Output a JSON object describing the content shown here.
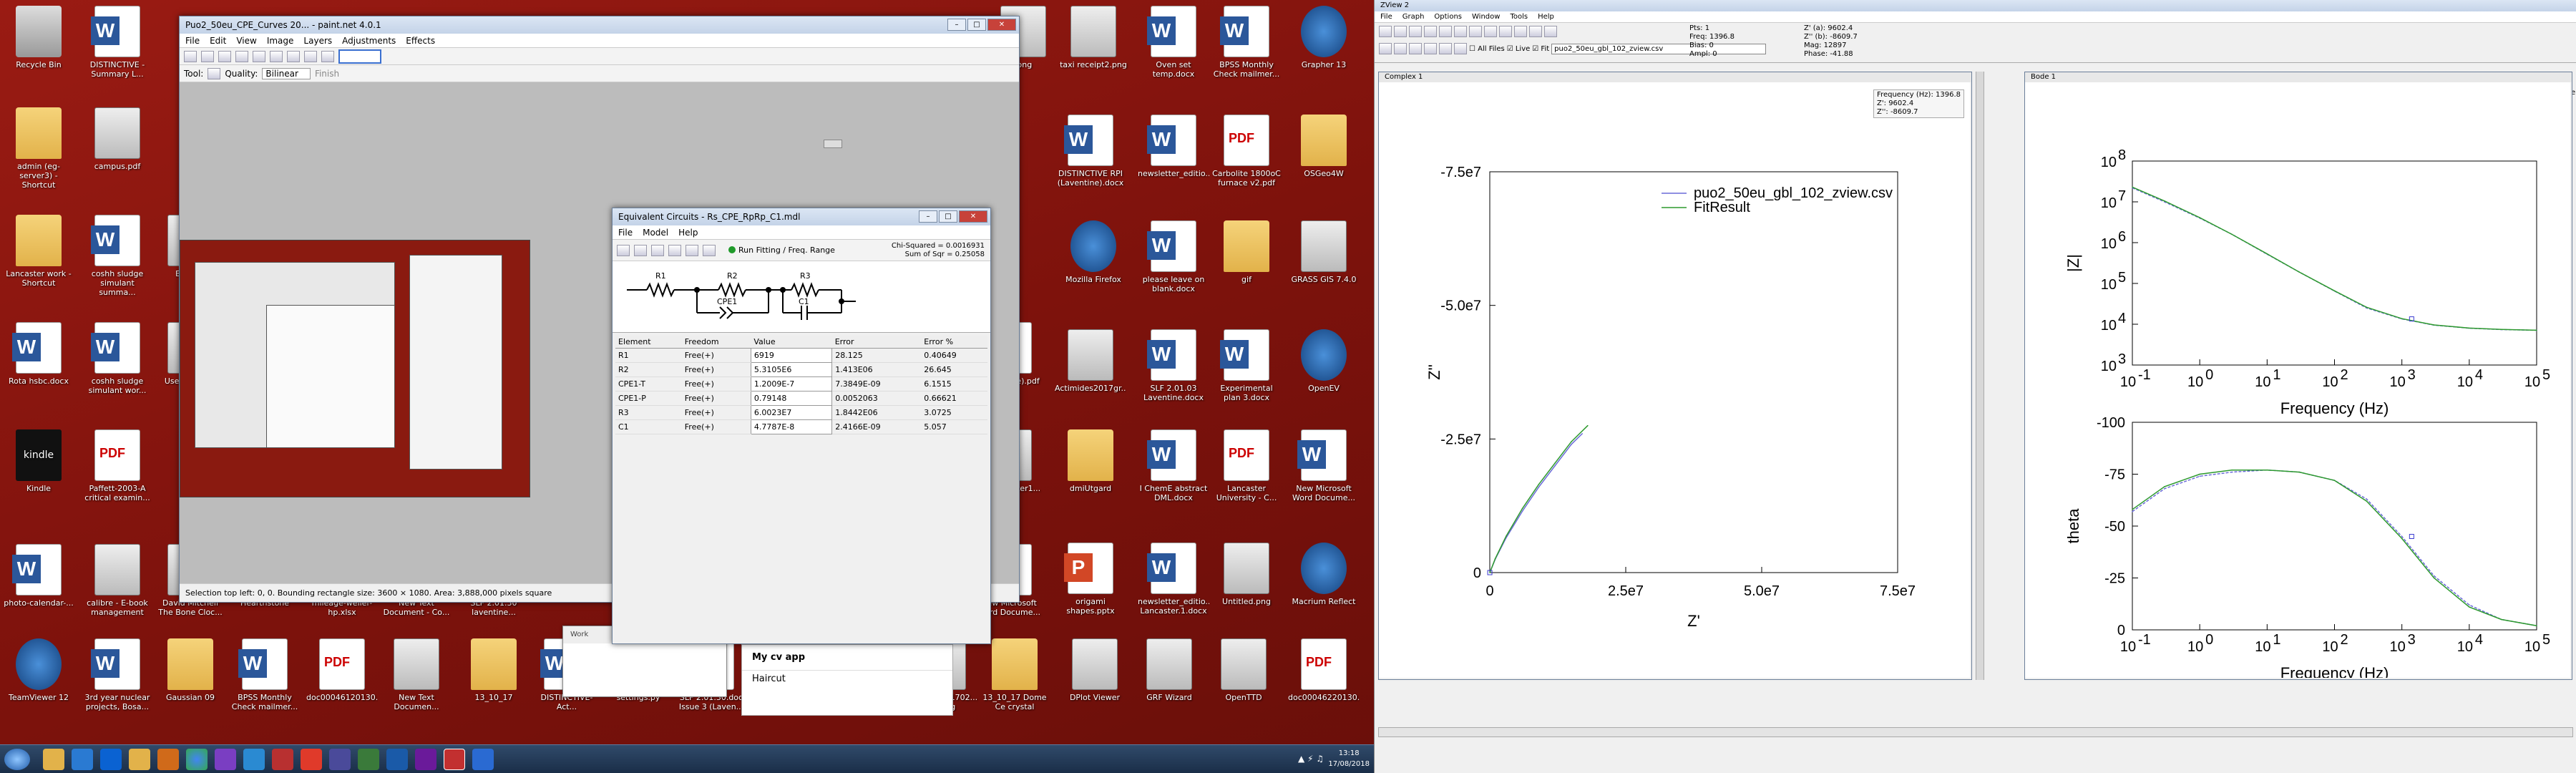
{
  "desktop": {
    "icons": [
      {
        "label": "Recycle Bin",
        "kind": "bin",
        "icon": "recycle-bin-icon"
      },
      {
        "label": "DISTINCTIVE - Summary L...",
        "kind": "word",
        "icon": "word-doc-icon"
      },
      {
        "label": "admin (eg-server3) - Shortcut",
        "kind": "folder",
        "icon": "folder-icon"
      },
      {
        "label": "campus.pdf",
        "kind": "img",
        "icon": "image-icon"
      },
      {
        "label": "Lancaster work - Shortcut",
        "kind": "folder",
        "icon": "folder-icon"
      },
      {
        "label": "coshh sludge simulant summa...",
        "kind": "word",
        "icon": "word-doc-icon"
      },
      {
        "label": "Bengl...",
        "kind": "img",
        "icon": "image-icon"
      },
      {
        "label": "Rota hsbc.docx",
        "kind": "word",
        "icon": "word-doc-icon"
      },
      {
        "label": "coshh sludge simulant wor...",
        "kind": "word",
        "icon": "word-doc-icon"
      },
      {
        "label": "Usei... Radi...",
        "kind": "img",
        "icon": "image-icon"
      },
      {
        "label": "Kindle",
        "kind": "kindle",
        "icon": "kindle-icon"
      },
      {
        "label": "Paffett-2003-A critical examin...",
        "kind": "pdf",
        "icon": "pdf-icon"
      },
      {
        "label": "photo-calendar-...",
        "kind": "word",
        "icon": "word-doc-icon"
      },
      {
        "label": "calibre - E-book management",
        "kind": "img",
        "icon": "calibre-icon"
      },
      {
        "label": "David Mitchell The Bone Cloc...",
        "kind": "img",
        "icon": "image-icon"
      },
      {
        "label": "Hearthstone",
        "kind": "img",
        "icon": "image-icon"
      },
      {
        "label": "mileage-weller-hp.xlsx",
        "kind": "xls",
        "icon": "excel-doc-icon"
      },
      {
        "label": "New Text Document - Co...",
        "kind": "img",
        "icon": "text-doc-icon"
      },
      {
        "label": "SLF 2.01.30 laventine...",
        "kind": "img",
        "icon": "image-icon"
      },
      {
        "label": "TeamViewer 12",
        "kind": "app",
        "icon": "teamviewer-icon"
      },
      {
        "label": "3rd year nuclear projects, Bosa...",
        "kind": "word",
        "icon": "word-doc-icon"
      },
      {
        "label": "Gaussian 09",
        "kind": "folder",
        "icon": "folder-icon"
      },
      {
        "label": "BPSS Monthly Check mailmer...",
        "kind": "word",
        "icon": "word-doc-icon"
      },
      {
        "label": "doc00046120130...",
        "kind": "pdf",
        "icon": "pdf-icon"
      },
      {
        "label": "New Text Documen...",
        "kind": "img",
        "icon": "text-doc-icon"
      },
      {
        "label": "13_10_17",
        "kind": "folder",
        "icon": "folder-icon"
      },
      {
        "label": "DISTINCTIVE-Act...",
        "kind": "word",
        "icon": "word-doc-icon"
      },
      {
        "label": "settings.py",
        "kind": "img",
        "icon": "python-icon"
      },
      {
        "label": "SLF 2.01.30.doc Issue 3 (Laven...",
        "kind": "word",
        "icon": "word-doc-icon"
      },
      {
        "label": "Cixin Liu - The Three Body ...",
        "kind": "img",
        "icon": "image-icon"
      },
      {
        "label": "Porosimeter micrometri...",
        "kind": "img",
        "icon": "image-icon"
      },
      {
        "label": "SKM_C3681702... p2.jpg",
        "kind": "img",
        "icon": "image-icon"
      },
      {
        "label": "13_10_17 Dome Ce crystal",
        "kind": "folder",
        "icon": "folder-icon"
      },
      {
        "label": "DPlot Viewer",
        "kind": "img",
        "icon": "dplot-icon"
      },
      {
        "label": "GRF Wizard",
        "kind": "img",
        "icon": "wizard-icon"
      },
      {
        "label": "OpenTTD",
        "kind": "img",
        "icon": "openttd-icon"
      },
      {
        "label": "doc00046220130...",
        "kind": "pdf",
        "icon": "pdf-icon"
      },
      {
        "label": ".png",
        "kind": "img",
        "icon": "image-icon"
      },
      {
        "label": "taxi receipt2.png",
        "kind": "img",
        "icon": "image-icon"
      },
      {
        "label": "Oven set temp.docx",
        "kind": "word",
        "icon": "word-doc-icon"
      },
      {
        "label": "BPSS Monthly Check mailmer...",
        "kind": "word",
        "icon": "word-doc-icon"
      },
      {
        "label": "Grapher 13",
        "kind": "app",
        "icon": "grapher-icon"
      },
      {
        "label": "DISTINCTIVE RPI (Laventine).docx",
        "kind": "word",
        "icon": "word-doc-icon"
      },
      {
        "label": "newsletter_editio...",
        "kind": "word",
        "icon": "word-doc-icon"
      },
      {
        "label": "Carbolite 1800oC furnace v2.pdf",
        "kind": "pdf",
        "icon": "pdf-icon"
      },
      {
        "label": "OSGeo4W",
        "kind": "folder",
        "icon": "folder-icon"
      },
      {
        "label": "Mozilla Firefox",
        "kind": "app",
        "icon": "firefox-icon"
      },
      {
        "label": "please leave on blank.docx",
        "kind": "word",
        "icon": "word-doc-icon"
      },
      {
        "label": "gif",
        "kind": "folder",
        "icon": "folder-icon"
      },
      {
        "label": "GRASS GIS 7.4.0",
        "kind": "img",
        "icon": "grass-gis-icon"
      },
      {
        "label": "Actimides2017gr...",
        "kind": "img",
        "icon": "image-icon"
      },
      {
        "label": "SLF 2.01.03 Laventine.docx",
        "kind": "word",
        "icon": "word-doc-icon"
      },
      {
        "label": "Experimental plan 3.docx",
        "kind": "word",
        "icon": "word-doc-icon"
      },
      {
        "label": "OpenEV",
        "kind": "app",
        "icon": "openev-icon"
      },
      {
        "label": "dmiUtgard",
        "kind": "folder",
        "icon": "folder-icon"
      },
      {
        "label": "I ChemE abstract DML.docx",
        "kind": "word",
        "icon": "word-doc-icon"
      },
      {
        "label": "Lancaster University - C...",
        "kind": "pdf",
        "icon": "pdf-icon"
      },
      {
        "label": "New Microsoft Word Docume...",
        "kind": "word",
        "icon": "word-doc-icon"
      },
      {
        "label": "origami shapes.pptx",
        "kind": "ppt",
        "icon": "powerpoint-doc-icon"
      },
      {
        "label": "newsletter_editio... Lancaster.1.docx",
        "kind": "word",
        "icon": "word-doc-icon"
      },
      {
        "label": "Untitled.png",
        "kind": "img",
        "icon": "image-icon"
      },
      {
        "label": "Macrium Reflect",
        "kind": "app",
        "icon": "macrium-icon"
      },
      {
        "label": "r Order oster1...",
        "kind": "img",
        "icon": "image-icon"
      },
      {
        "label": "New Microsoft Word Docume...",
        "kind": "word",
        "icon": "word-doc-icon"
      },
      {
        "label": "nter1 nline).pdf",
        "kind": "pdf",
        "icon": "pdf-icon"
      },
      {
        "label": "Work",
        "kind": "folder",
        "icon": "folder-icon"
      }
    ]
  },
  "paint": {
    "title": "Puo2_50eu_CPE_Curves 20... - paint.net 4.0.1",
    "menu": [
      "File",
      "Edit",
      "View",
      "Image",
      "Layers",
      "Adjustments",
      "Effects"
    ],
    "tool_label": "Tool:",
    "quality_label": "Quality:",
    "quality_value": "Bilinear",
    "finish_label": "Finish",
    "status": "Selection top left: 0, 0. Bounding rectangle size: 3600 × 1080. Area: 3,888,000 pixels square"
  },
  "equiv": {
    "title": "Equivalent Circuits - Rs_CPE_RpRp_C1.mdl",
    "menu": [
      "File",
      "Model",
      "Help"
    ],
    "run_label": "Run Fitting / Freq. Range",
    "chi_squared": "Chi-Squared = 0.0016931",
    "sum_sqr": "Sum of Sqr = 0.25058",
    "circuit_labels": [
      "R1",
      "R2",
      "CPE1",
      "R3",
      "C1"
    ],
    "columns": [
      "Element",
      "Freedom",
      "Value",
      "Error",
      "Error %"
    ],
    "rows": [
      {
        "element": "R1",
        "freedom": "Free(+)",
        "value": "6919",
        "error": "28.125",
        "error_pct": "0.40649"
      },
      {
        "element": "R2",
        "freedom": "Free(+)",
        "value": "5.3105E6",
        "error": "1.413E06",
        "error_pct": "26.645"
      },
      {
        "element": "CPE1-T",
        "freedom": "Free(+)",
        "value": "1.2009E-7",
        "error": "7.3849E-09",
        "error_pct": "6.1515"
      },
      {
        "element": "CPE1-P",
        "freedom": "Free(+)",
        "value": "0.79148",
        "error": "0.0052063",
        "error_pct": "0.66621"
      },
      {
        "element": "R3",
        "freedom": "Free(+)",
        "value": "6.0023E7",
        "error": "1.8442E06",
        "error_pct": "3.0725"
      },
      {
        "element": "C1",
        "freedom": "Free(+)",
        "value": "4.7787E-8",
        "error": "2.4166E-09",
        "error_pct": "5.057"
      }
    ]
  },
  "work_popup": {
    "tab": "Work",
    "item1": "My cv app",
    "item2": "Haircut"
  },
  "taskbar": {
    "time": "13:18",
    "date": "17/08/2018"
  },
  "zview": {
    "title": "ZView 2",
    "menu": [
      "File",
      "Graph",
      "Options",
      "Window",
      "Tools",
      "Help"
    ],
    "all_files_label": "All Files",
    "live_label": "Live",
    "fit_label": "Fit",
    "file_select": "puo2_50eu_gbl_102_zview.csv",
    "readout_left": [
      "Pts: 1",
      "Freq: 1396.8",
      "Bias: 0",
      "Ampl: 0"
    ],
    "readout_right": [
      "Z' (a): 9602.4",
      "Z'' (b): -8609.7",
      "Mag: 12897",
      "Phase: -41.88"
    ],
    "complex_title": "Complex 1",
    "bode_title": "Bode 1",
    "freq_box": [
      "Frequency (Hz): 1396.8",
      "Z': 9602.4",
      "Z'': -8609.7"
    ],
    "sv_label": "sv",
    "e_label": "e"
  },
  "chart_data": [
    {
      "type": "line",
      "name": "complex-plane",
      "xlabel": "Z'",
      "ylabel": "Z''",
      "xlim": [
        0,
        75000000.0
      ],
      "ylim": [
        0,
        -75000000.0
      ],
      "xticks": [
        "0",
        "2.5e7",
        "5.0e7",
        "7.5e7"
      ],
      "yticks": [
        "-7.5e7",
        "-5.0e7",
        "-2.5e7",
        "0"
      ],
      "legend": "top-right",
      "series": [
        {
          "name": "puo2_50eu_gbl_102_zview.csv",
          "color": "#6a6ad8",
          "x": [
            6919,
            1000000.0,
            3000000.0,
            6000000.0,
            9000000.0,
            12000000.0,
            15000000.0,
            17000000.0
          ],
          "y": [
            0,
            -2500000.0,
            -6500000.0,
            -11500000.0,
            -16000000.0,
            -20000000.0,
            -24000000.0,
            -26000000.0
          ]
        },
        {
          "name": "FitResult",
          "color": "#2d9a2d",
          "x": [
            6919,
            1000000.0,
            3000000.0,
            6000000.0,
            9000000.0,
            12000000.0,
            15000000.0,
            18000000.0
          ],
          "y": [
            0,
            -2600000.0,
            -6800000.0,
            -12000000.0,
            -16500000.0,
            -20500000.0,
            -24500000.0,
            -27500000.0
          ]
        }
      ]
    },
    {
      "type": "line",
      "name": "bode-magnitude",
      "xlabel": "Frequency (Hz)",
      "ylabel": "|Z|",
      "scale": "log-log",
      "xlim": [
        0.1,
        100000
      ],
      "ylim": [
        1000,
        100000000
      ],
      "xticks": [
        "10",
        "10",
        "10",
        "10",
        "10",
        "10",
        "10"
      ],
      "xtick_exp": [
        "-1",
        "0",
        "1",
        "2",
        "3",
        "4",
        "5"
      ],
      "yticks": [
        "10",
        "10",
        "10",
        "10",
        "10",
        "10"
      ],
      "ytick_exp": [
        "8",
        "7",
        "6",
        "5",
        "4",
        "3"
      ],
      "series": [
        {
          "name": "data",
          "color": "#6a6ad8",
          "x": [
            0.1,
            0.3,
            1,
            3,
            10,
            30,
            100,
            300,
            1000,
            3000,
            10000,
            30000,
            100000
          ],
          "y": [
            22000000.0,
            10000000.0,
            4000000.0,
            1600000.0,
            520000.0,
            190000.0,
            65000.0,
            25000.0,
            13500.0,
            9500,
            8000,
            7400,
            7100
          ]
        },
        {
          "name": "FitResult",
          "color": "#2d9a2d",
          "x": [
            0.1,
            0.3,
            1,
            3,
            10,
            30,
            100,
            300,
            1000,
            3000,
            10000,
            30000,
            100000
          ],
          "y": [
            23000000.0,
            10500000.0,
            4100000.0,
            1600000.0,
            530000.0,
            190000.0,
            66000.0,
            26000.0,
            13700.0,
            9600,
            8050,
            7450,
            7120
          ]
        }
      ]
    },
    {
      "type": "line",
      "name": "bode-phase",
      "xlabel": "Frequency (Hz)",
      "ylabel": "theta",
      "scale": "log-x",
      "xlim": [
        0.1,
        100000
      ],
      "ylim": [
        0,
        -100
      ],
      "xticks": [
        "10",
        "10",
        "10",
        "10",
        "10",
        "10",
        "10"
      ],
      "xtick_exp": [
        "-1",
        "0",
        "1",
        "2",
        "3",
        "4",
        "5"
      ],
      "yticks": [
        "-100",
        "-75",
        "-50",
        "-25",
        "0"
      ],
      "series": [
        {
          "name": "data",
          "color": "#6a6ad8",
          "x": [
            0.1,
            0.3,
            1,
            3,
            10,
            30,
            100,
            300,
            1000,
            3000,
            10000,
            30000,
            100000
          ],
          "y": [
            -57,
            -68,
            -74,
            -76,
            -77,
            -76,
            -72,
            -63,
            -45,
            -26,
            -12,
            -5,
            -2
          ]
        },
        {
          "name": "FitResult",
          "color": "#2d9a2d",
          "x": [
            0.1,
            0.3,
            1,
            3,
            10,
            30,
            100,
            300,
            1000,
            3000,
            10000,
            30000,
            100000
          ],
          "y": [
            -58,
            -69,
            -75,
            -77,
            -77,
            -76,
            -72,
            -62,
            -44,
            -25,
            -11,
            -5,
            -2
          ]
        }
      ]
    }
  ]
}
